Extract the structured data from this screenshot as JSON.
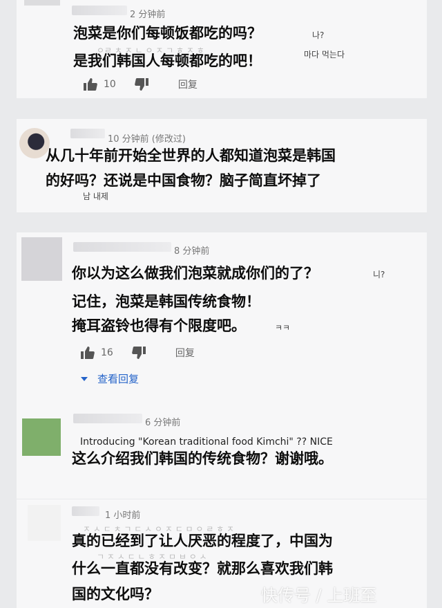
{
  "comments": [
    {
      "time": "2 分钟前",
      "lines": [
        "泡菜是你们每顿饭都吃的吗？",
        "是我们韩国人每顿都吃的吧！"
      ],
      "korean_overlay": [
        "나?",
        "마다 먹는다"
      ],
      "likes": "10",
      "reply_label": "回复"
    },
    {
      "time": "10 分钟前 (修改过)",
      "lines": [
        "从几十年前开始全世界的人都知道泡菜是韩国",
        "的好吗？还说是中国食物？脑子简直坏掉了"
      ],
      "korean_overlay": [
        "남 내제"
      ]
    },
    {
      "time": "8 分钟前",
      "lines": [
        "你以为这么做我们泡菜就成你们的了？",
        "记住，泡菜是韩国传统食物！",
        "掩耳盗铃也得有个限度吧。"
      ],
      "korean_overlay": [
        "니?",
        "ㅋㅋ"
      ],
      "likes": "16",
      "reply_label": "回复",
      "view_replies": "查看回复"
    },
    {
      "time": "6 分钟前",
      "english_line": "Introducing \"Korean traditional food Kimchi\" ?? NICE",
      "lines": [
        "这么介绍我们韩国的传统食物？谢谢哦。"
      ]
    },
    {
      "time": "1 小时前",
      "lines": [
        "真的已经到了让人厌恶的程度了，中国为",
        "什么一直都没有改变？就那么喜欢我们韩",
        "国的文化吗？"
      ]
    }
  ],
  "watermark": "快传号 / 上班至"
}
